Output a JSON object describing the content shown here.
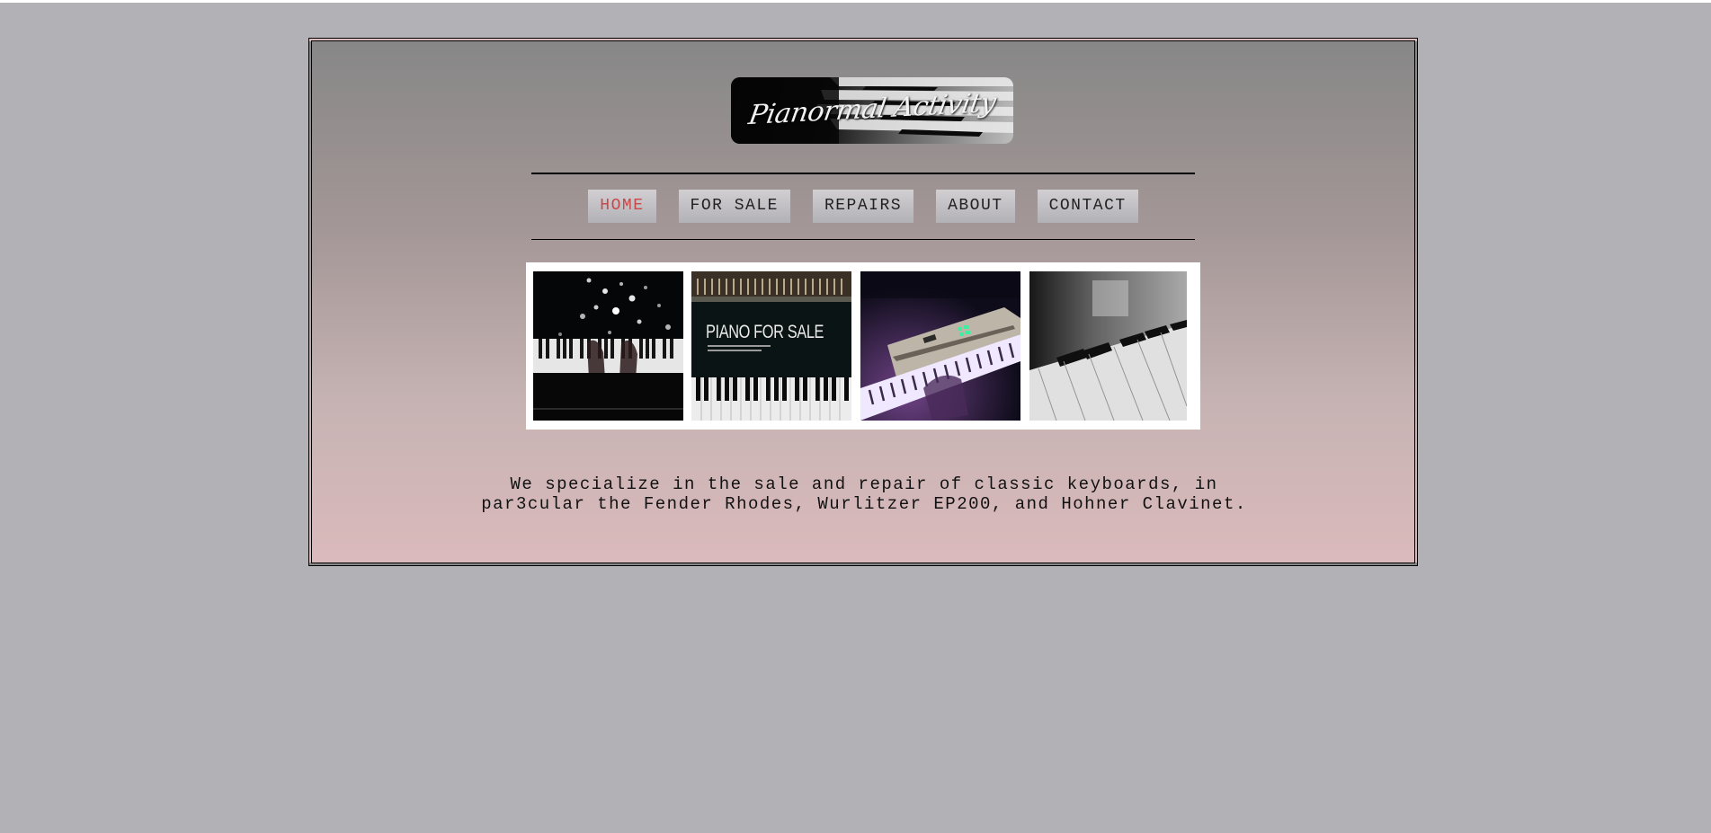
{
  "brand": {
    "logo_text": "Pianormal Activity"
  },
  "nav": {
    "items": [
      {
        "label": "HOME",
        "active": true
      },
      {
        "label": "FOR SALE",
        "active": false
      },
      {
        "label": "REPAIRS",
        "active": false
      },
      {
        "label": "ABOUT",
        "active": false
      },
      {
        "label": "CONTACT",
        "active": false
      }
    ]
  },
  "gallery": {
    "images": [
      {
        "icon": "piano-hands-lights-photo"
      },
      {
        "icon": "piano-for-sale-photo",
        "caption": "PIANO FOR SALE"
      },
      {
        "icon": "synth-keyboard-photo"
      },
      {
        "icon": "piano-keys-bw-photo"
      }
    ]
  },
  "main": {
    "tagline": "We specialize in the sale and repair of classic keyboards, in par3cular the Fender Rhodes, Wurlitzer EP200, and Hohner Clavinet."
  },
  "colors": {
    "page_background": "#b2b1b6",
    "gradient_top": "#878787",
    "gradient_bottom": "#dbbabc",
    "nav_active": "#c94848",
    "nav_text": "#222222"
  }
}
